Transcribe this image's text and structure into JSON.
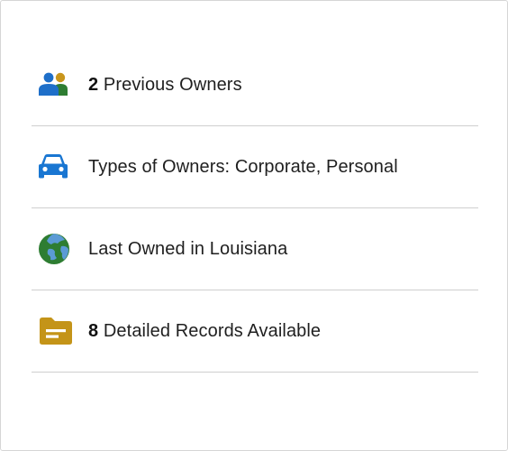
{
  "summary": {
    "items": [
      {
        "icon": "people-icon",
        "count": "2",
        "label": " Previous Owners"
      },
      {
        "icon": "car-icon",
        "count": "",
        "label": "Types of Owners: Corporate, Personal"
      },
      {
        "icon": "globe-icon",
        "count": "",
        "label": "Last Owned in Louisiana"
      },
      {
        "icon": "folder-icon",
        "count": "8",
        "label": " Detailed Records Available"
      }
    ]
  },
  "colors": {
    "people_blue": "#1e6fc9",
    "people_gold": "#c9961c",
    "people_green": "#2e7d32",
    "car_blue": "#1976d2",
    "globe_green": "#2e7d32",
    "globe_blue": "#5b9bd5",
    "folder_gold": "#c49418",
    "divider": "#cfcfcf",
    "card_border": "#d6d6d6"
  }
}
